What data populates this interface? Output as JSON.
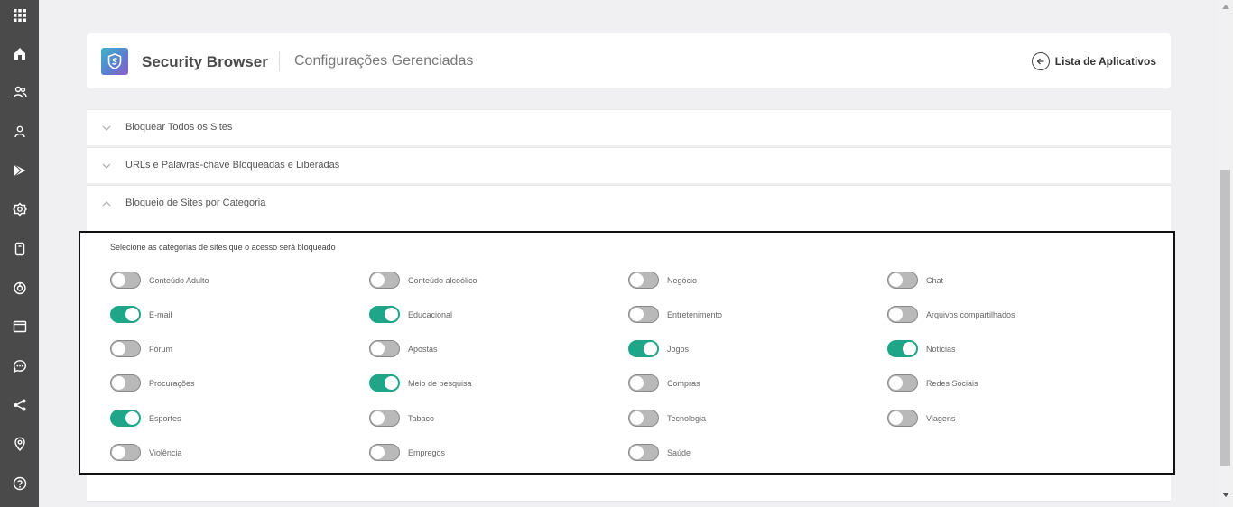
{
  "header": {
    "app_title": "Security Browser",
    "subtitle": "Configurações Gerenciadas",
    "back_label": "Lista de Aplicativos"
  },
  "sidebar": {
    "icons": [
      "apps-grid-icon",
      "home-icon",
      "users-icon",
      "user-icon",
      "play-store-icon",
      "settings-icon",
      "device-icon",
      "power-icon",
      "browser-window-icon",
      "chat-icon",
      "share-icon",
      "location-icon",
      "help-icon"
    ]
  },
  "accordion": [
    {
      "label": "Bloquear Todos os Sites",
      "expanded": false
    },
    {
      "label": "URLs e Palavras-chave Bloqueadas e Liberadas",
      "expanded": false
    },
    {
      "label": "Bloqueio de Sites por Categoria",
      "expanded": true
    }
  ],
  "categories": {
    "instructions": "Selecione as categorias de sites que o acesso será bloqueado",
    "items": [
      {
        "label": "Conteúdo Adulto",
        "on": false
      },
      {
        "label": "Conteúdo alcoólico",
        "on": false
      },
      {
        "label": "Negócio",
        "on": false
      },
      {
        "label": "Chat",
        "on": false
      },
      {
        "label": "E-mail",
        "on": true
      },
      {
        "label": "Educacional",
        "on": true
      },
      {
        "label": "Entretenimento",
        "on": false
      },
      {
        "label": "Arquivos compartilhados",
        "on": false
      },
      {
        "label": "Fórum",
        "on": false
      },
      {
        "label": "Apostas",
        "on": false
      },
      {
        "label": "Jogos",
        "on": true
      },
      {
        "label": "Notícias",
        "on": true
      },
      {
        "label": "Procurações",
        "on": false
      },
      {
        "label": "Meio de pesquisa",
        "on": true
      },
      {
        "label": "Compras",
        "on": false
      },
      {
        "label": "Redes Sociais",
        "on": false
      },
      {
        "label": "Esportes",
        "on": true
      },
      {
        "label": "Tabaco",
        "on": false
      },
      {
        "label": "Tecnologia",
        "on": false
      },
      {
        "label": "Viagens",
        "on": false
      },
      {
        "label": "Violência",
        "on": false
      },
      {
        "label": "Empregos",
        "on": false
      },
      {
        "label": "Saúde",
        "on": false
      }
    ]
  },
  "colors": {
    "sidebar_bg": "#4a4a4a",
    "toggle_on": "#1fa688",
    "toggle_off": "#b9b9b9"
  }
}
